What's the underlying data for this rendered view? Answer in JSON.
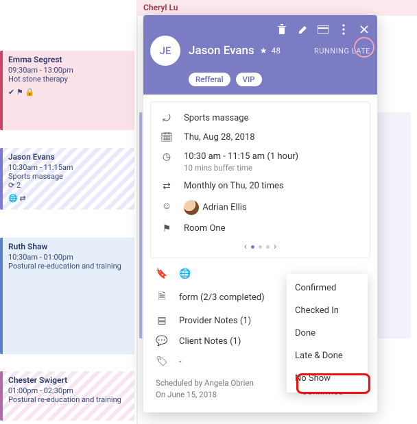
{
  "columns": {
    "right_header": "Cheryl Lu"
  },
  "events": {
    "left": [
      {
        "title": "Emma Segrest",
        "time": "09:30am - 13:00pm",
        "sub": "Hot stone therapy"
      },
      {
        "title": "Jason Evans",
        "time": "10:30am - 11:15am",
        "sub": "Sports massage",
        "extra": "⟳ 2"
      },
      {
        "title": "Ruth Shaw",
        "time": "10:30am - 01:00pm",
        "sub": "Postural re-education and training"
      },
      {
        "title": "Chester Swigert",
        "time": "01:00pm - 02:30pm",
        "sub": "Postural re-education and training"
      }
    ]
  },
  "popover": {
    "initials": "JE",
    "name": "Jason Evans",
    "age": "48",
    "status": "RUNNING LATE",
    "chips": [
      "Refferal",
      "VIP"
    ],
    "details": {
      "service": "Sports massage",
      "date": "Thu, Aug 28, 2018",
      "time": "10:30 am - 11:15 am (1 hour)",
      "buffer": "10 mins buffer time",
      "recurrence": "Monthly on Thu, 20 times",
      "provider": "Adrian Ellis",
      "room": "Room One"
    },
    "meta": {
      "form": "form (2/3 completed)",
      "provider_notes": "Provider Notes (1)",
      "client_notes": "Client Notes (1)",
      "tag": "-"
    },
    "scheduled_by_label": "Scheduled by Angela Obrien",
    "scheduled_on_label": "On June 15, 2018",
    "status_selected": "Confirmed"
  },
  "status_options": [
    "Confirmed",
    "Checked In",
    "Done",
    "Late & Done",
    "No Show"
  ]
}
